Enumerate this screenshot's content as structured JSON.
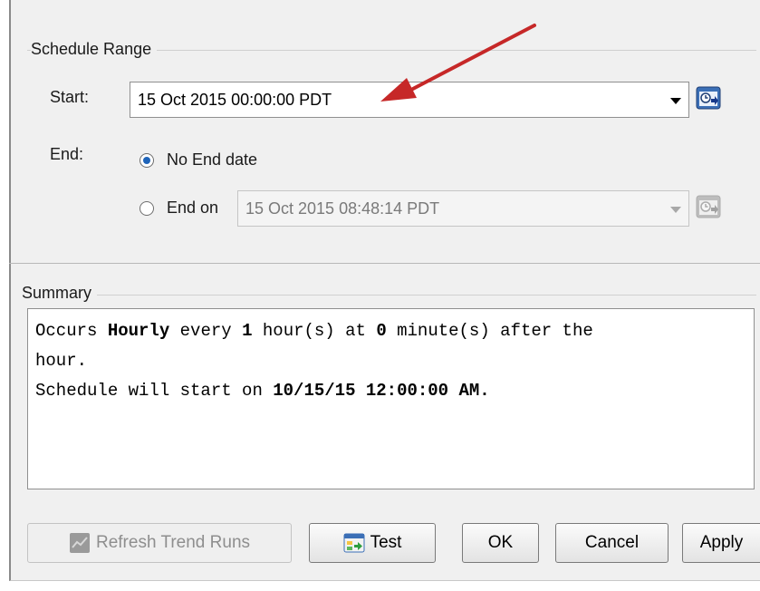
{
  "schedule_range": {
    "title": "Schedule Range",
    "start_label": "Start:",
    "start_value": "15 Oct 2015 00:00:00 PDT",
    "end_label": "End:",
    "no_end_label": "No End date",
    "end_on_label": "End on",
    "end_on_value": "15 Oct 2015 08:48:14 PDT",
    "selected_end_option": "no-end-date"
  },
  "summary": {
    "title": "Summary",
    "line1_a": "Occurs ",
    "line1_b": "Hourly",
    "line1_c": " every ",
    "line1_d": "1",
    "line1_e": " hour(s) at ",
    "line1_f": "0",
    "line1_g": " minute(s) after the",
    "line2": "hour.",
    "line3_a": "Schedule will start on ",
    "line3_b": "10/15/15 12:00:00 AM."
  },
  "buttons": {
    "refresh": "Refresh Trend Runs",
    "test": "Test",
    "ok": "OK",
    "cancel": "Cancel",
    "apply": "Apply"
  },
  "colors": {
    "annotation_arrow": "#c62828",
    "radio_selected": "#1f64b9"
  },
  "icons": {
    "calendar": "calendar-clock-icon",
    "refresh": "refresh-trend-icon",
    "test": "test-run-icon"
  }
}
